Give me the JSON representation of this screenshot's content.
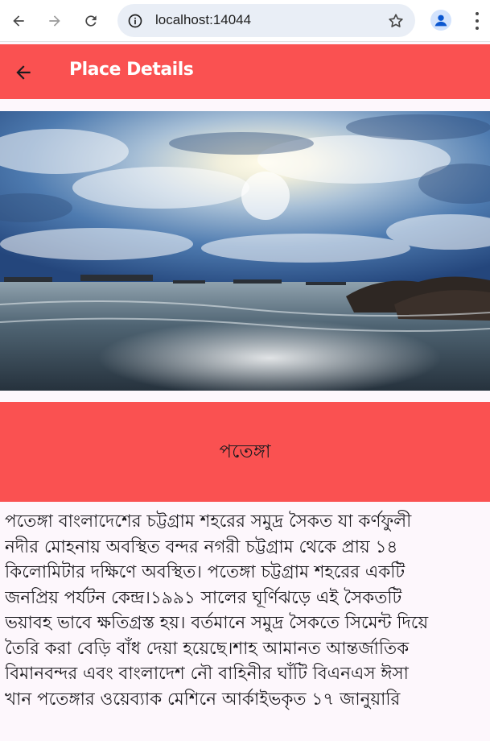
{
  "browser": {
    "url": "localhost:14044"
  },
  "app_bar": {
    "title": "Place Details"
  },
  "place": {
    "name": "পতেঙ্গা",
    "description_lines": [
      "পতেঙ্গা বাংলাদেশের চট্টগ্রাম শহরের সমুদ্র সৈকত যা কর্ণফুলী",
      "নদীর মোহনায় অবস্থিত বন্দর নগরী চট্টগ্রাম থেকে প্রায় ১৪",
      "কিলোমিটার দক্ষিণে অবস্থিত। পতেঙ্গা চট্টগ্রাম শহরের একটি",
      "জনপ্রিয় পর্যটন কেন্দ্র।১৯৯১ সালের ঘূর্ণিঝড়ে এই সৈকতটি",
      "ভয়াবহ ভাবে ক্ষতিগ্রস্ত হয়। বর্তমানে সমুদ্র সৈকতে সিমেন্ট দিয়ে",
      "তৈরি করা বেড়ি বাঁধ দেয়া হয়েছে।শাহ আমানত আন্তর্জাতিক",
      "বিমানবন্দর এবং বাংলাদেশ নৌ বাহিনীর ঘাঁটি বিএনএস ঈসা",
      "খান পতেঙ্গার ওয়েব্যাক মেশিনে আর্কাইভকৃত ১৭ জানুয়ারি"
    ]
  },
  "colors": {
    "accent": "#fa5151",
    "background": "#fdf7fc",
    "browser_bar": "#ffffff",
    "omnibox": "#e9eef6"
  },
  "icons": {
    "browser_back": "arrow-left-icon",
    "browser_forward": "arrow-right-icon",
    "reload": "reload-icon",
    "site_info": "site-info-icon",
    "bookmark": "star-icon",
    "profile": "avatar-icon",
    "menu": "kebab-menu-icon",
    "app_back": "arrow-left-icon"
  }
}
